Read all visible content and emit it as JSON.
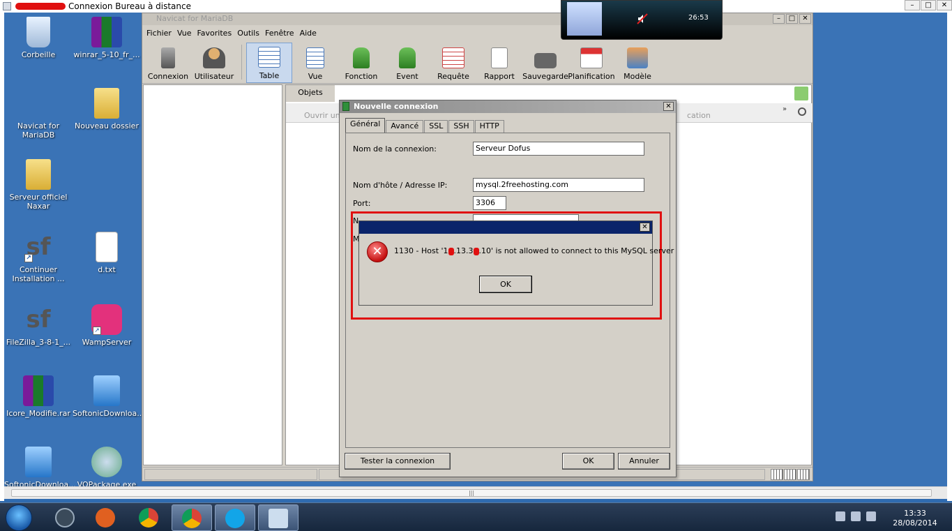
{
  "rdp": {
    "title": "Connexion Bureau à distance",
    "controls": [
      "–",
      "□",
      "✕"
    ]
  },
  "desktop_icons": [
    {
      "label": "Corbeille",
      "icon": "recycle-bin-icon"
    },
    {
      "label": "winrar_5-10_fr_...",
      "icon": "winrar-icon"
    },
    {
      "label": "Navicat for MariaDB",
      "icon": "navicat-icon"
    },
    {
      "label": "Nouveau dossier",
      "icon": "folder-icon"
    },
    {
      "label": "Serveur officiel Naxar",
      "icon": "folder-icon"
    },
    {
      "label": "Continuer Installation ...",
      "icon": "sf-icon"
    },
    {
      "label": "d.txt",
      "icon": "text-file-icon"
    },
    {
      "label": "FileZilla_3-8-1_...",
      "icon": "sf-icon"
    },
    {
      "label": "WampServer",
      "icon": "wamp-icon"
    },
    {
      "label": "Icore_Modifie.rar",
      "icon": "winrar-icon"
    },
    {
      "label": "SoftonicDownloa...",
      "icon": "softonic-icon"
    },
    {
      "label": "SoftonicDownloa...",
      "icon": "softonic-icon"
    },
    {
      "label": "VOPackage.exe",
      "icon": "package-icon"
    }
  ],
  "navicat": {
    "title": "Navicat for MariaDB",
    "menu": [
      "Fichier",
      "Vue",
      "Favorites",
      "Outils",
      "Fenêtre",
      "Aide"
    ],
    "toolbar": [
      {
        "label": "Connexion",
        "icon": "connection-icon"
      },
      {
        "label": "Utilisateur",
        "icon": "user-icon"
      },
      {
        "label": "Table",
        "icon": "table-icon"
      },
      {
        "label": "Vue",
        "icon": "view-icon"
      },
      {
        "label": "Fonction",
        "icon": "function-icon"
      },
      {
        "label": "Event",
        "icon": "event-icon"
      },
      {
        "label": "Requête",
        "icon": "query-icon"
      },
      {
        "label": "Rapport",
        "icon": "report-icon"
      },
      {
        "label": "Sauvegarde",
        "icon": "backup-icon"
      },
      {
        "label": "Planification",
        "icon": "schedule-icon"
      },
      {
        "label": "Modèle",
        "icon": "model-icon"
      }
    ],
    "objets_tab": "Objets",
    "ouvrir": "Ouvrir une",
    "location": "cation",
    "chevron": "»"
  },
  "new_connection": {
    "title": "Nouvelle connexion",
    "tabs": [
      "Général",
      "Avancé",
      "SSL",
      "SSH",
      "HTTP"
    ],
    "fields": {
      "name_label": "Nom de la connexion:",
      "name_value": "Serveur Dofus",
      "host_label": "Nom d'hôte / Adresse IP:",
      "host_value": "mysql.2freehosting.com",
      "port_label": "Port:",
      "port_value": "3306",
      "user_label_partial": "N",
      "pass_label_partial": "M"
    },
    "buttons": {
      "test": "Tester la connexion",
      "ok": "OK",
      "cancel": "Annuler"
    }
  },
  "error_dialog": {
    "message_parts": [
      "1130 - Host '1",
      ".13.3",
      ".10' is not allowed to connect to this MySQL server"
    ],
    "ok": "OK",
    "close": "✕"
  },
  "media": {
    "time": "26:53"
  },
  "taskbar": {
    "time": "13:33",
    "date": "28/08/2014"
  }
}
